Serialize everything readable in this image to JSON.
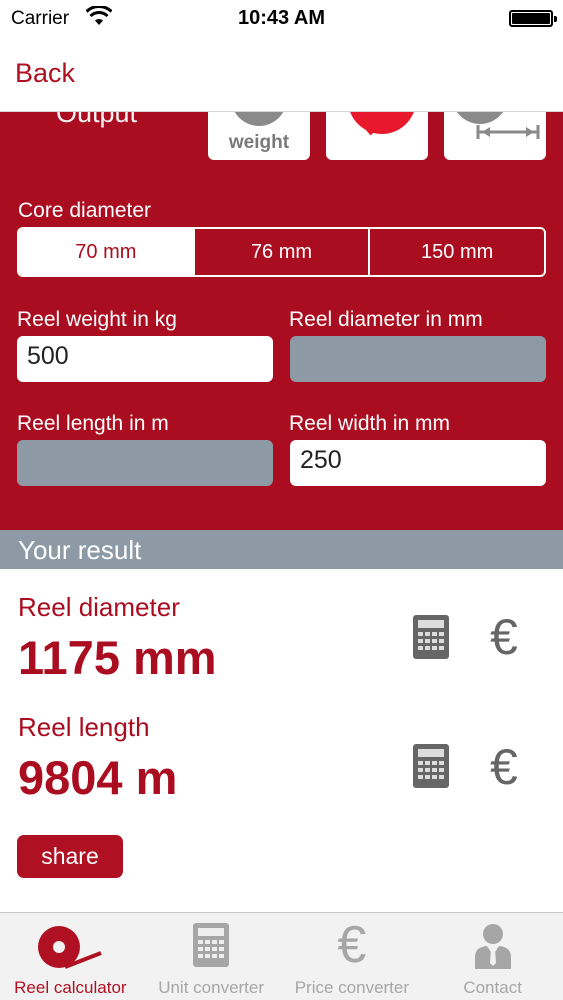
{
  "status_bar": {
    "carrier": "Carrier",
    "time": "10:43 AM"
  },
  "nav": {
    "back_label": "Back"
  },
  "output": {
    "label": "Output",
    "options": [
      {
        "caption": "weight",
        "icon": "weight-icon"
      },
      {
        "caption": "",
        "icon": "reel-diameter-icon"
      },
      {
        "caption": "",
        "icon": "reel-length-icon"
      }
    ]
  },
  "core_diameter": {
    "label": "Core diameter",
    "options": [
      "70 mm",
      "76 mm",
      "150 mm"
    ],
    "selected": "70 mm"
  },
  "inputs": {
    "reel_weight": {
      "label": "Reel weight in kg",
      "value": "500"
    },
    "reel_diameter": {
      "label": "Reel diameter in mm",
      "value": ""
    },
    "reel_length": {
      "label": "Reel length in m",
      "value": ""
    },
    "reel_width": {
      "label": "Reel width in mm",
      "value": "250"
    }
  },
  "result": {
    "header": "Your result",
    "items": [
      {
        "label": "Reel diameter",
        "value": "1175 mm"
      },
      {
        "label": "Reel length",
        "value": "9804 m"
      }
    ],
    "euro_symbol": "€",
    "share_label": "share"
  },
  "tabs": [
    {
      "label": "Reel calculator",
      "icon": "reel-icon",
      "active": true
    },
    {
      "label": "Unit converter",
      "icon": "calculator-icon",
      "active": false
    },
    {
      "label": "Price converter",
      "icon": "euro-icon",
      "active": false
    },
    {
      "label": "Contact",
      "icon": "person-icon",
      "active": false
    }
  ],
  "colors": {
    "brand_red": "#ab0d20",
    "result_header": "#8d9aa6",
    "inactive_tab": "#a6a6a6"
  }
}
